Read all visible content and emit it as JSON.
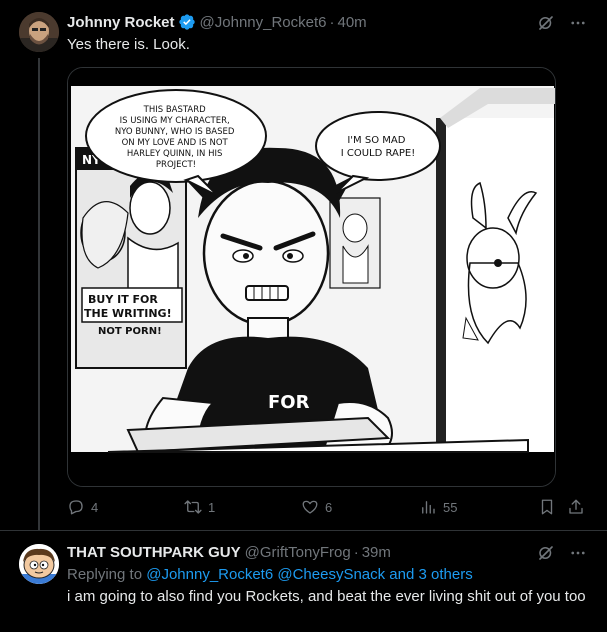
{
  "tweet": {
    "author_name": "Johnny Rocket",
    "author_handle": "@Johnny_Rocket6",
    "separator": "·",
    "time": "40m",
    "text": "Yes there is. Look.",
    "comic": {
      "speech_left": [
        "THIS BASTARD",
        "IS USING MY CHARACTER,",
        "NYO BUNNY, WHO IS BASED",
        "ON MY LOVE AND IS NOT",
        "HARLEY QUINN, IN HIS",
        "PROJECT!"
      ],
      "speech_right": [
        "I'M SO MAD",
        "I COULD RAPE!"
      ],
      "poster_top": "NYO BUNNY",
      "poster_banner": [
        "BUY IT FOR",
        "THE WRITING!"
      ],
      "poster_bottom": "NOT PORN!",
      "shirt_text": "FOR"
    },
    "stats": {
      "replies": "4",
      "reposts": "1",
      "likes": "6",
      "views": "55"
    }
  },
  "reply": {
    "author_name": "THAT SOUTHPARK GUY",
    "author_handle": "@GriftTonyFrog",
    "separator": "·",
    "time": "39m",
    "replying_to_label": "Replying to",
    "replying_to_users": "@Johnny_Rocket6 @CheesySnack and 3 others",
    "text": "i am going to also find you Rockets, and beat the ever living shit out of you too"
  },
  "colors": {
    "background": "#000000",
    "text_primary": "#e7e9ea",
    "text_secondary": "#71767b",
    "accent": "#1d9bf0",
    "border": "#2f3336"
  }
}
